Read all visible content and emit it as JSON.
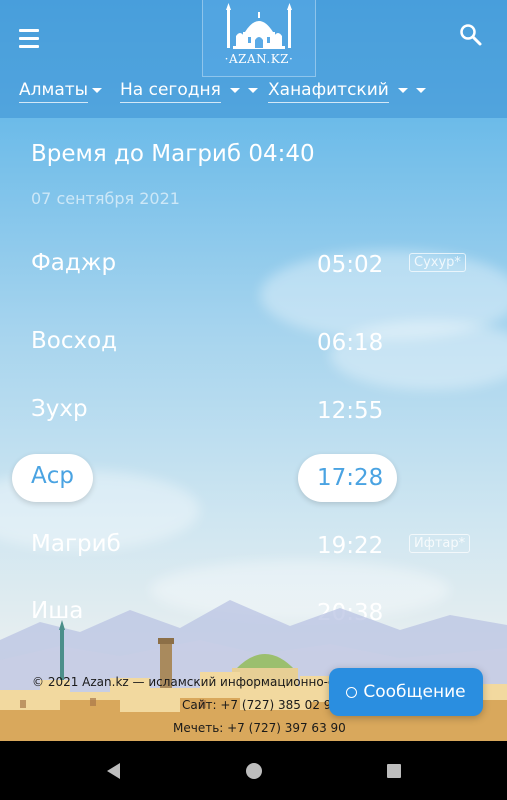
{
  "header": {
    "logo_text": "·AZAN.KZ·",
    "menu_icon": "hamburger-menu-icon",
    "search_icon": "search-icon"
  },
  "filters": {
    "city": "Алматы",
    "period": "На сегодня",
    "madhab": "Ханафитский"
  },
  "countdown": "Время до Магриб 04:40",
  "date": "07 сентября 2021",
  "prayers": [
    {
      "name": "Фаджр",
      "time": "05:02",
      "tag": "Сухур*"
    },
    {
      "name": "Восход",
      "time": "06:18",
      "tag": ""
    },
    {
      "name": "Зухр",
      "time": "12:55",
      "tag": ""
    },
    {
      "name": "Аср",
      "time": "17:28",
      "tag": "",
      "highlighted": true
    },
    {
      "name": "Магриб",
      "time": "19:22",
      "tag": "Ифтар*"
    },
    {
      "name": "Иша",
      "time": "20:38",
      "tag": ""
    }
  ],
  "footer": {
    "copyright": "©  2021 Azan.kz — исламский информационно-об",
    "site_phone": "Сайт: +7 (727) 385 02 95",
    "mosque_phone": "Мечеть: +7 (727) 397 63 90"
  },
  "message_button": "Сообщение",
  "colors": {
    "accent": "#2a8ee0",
    "highlight_text": "#4aa3e2",
    "header_bg": "#3d92d4"
  }
}
